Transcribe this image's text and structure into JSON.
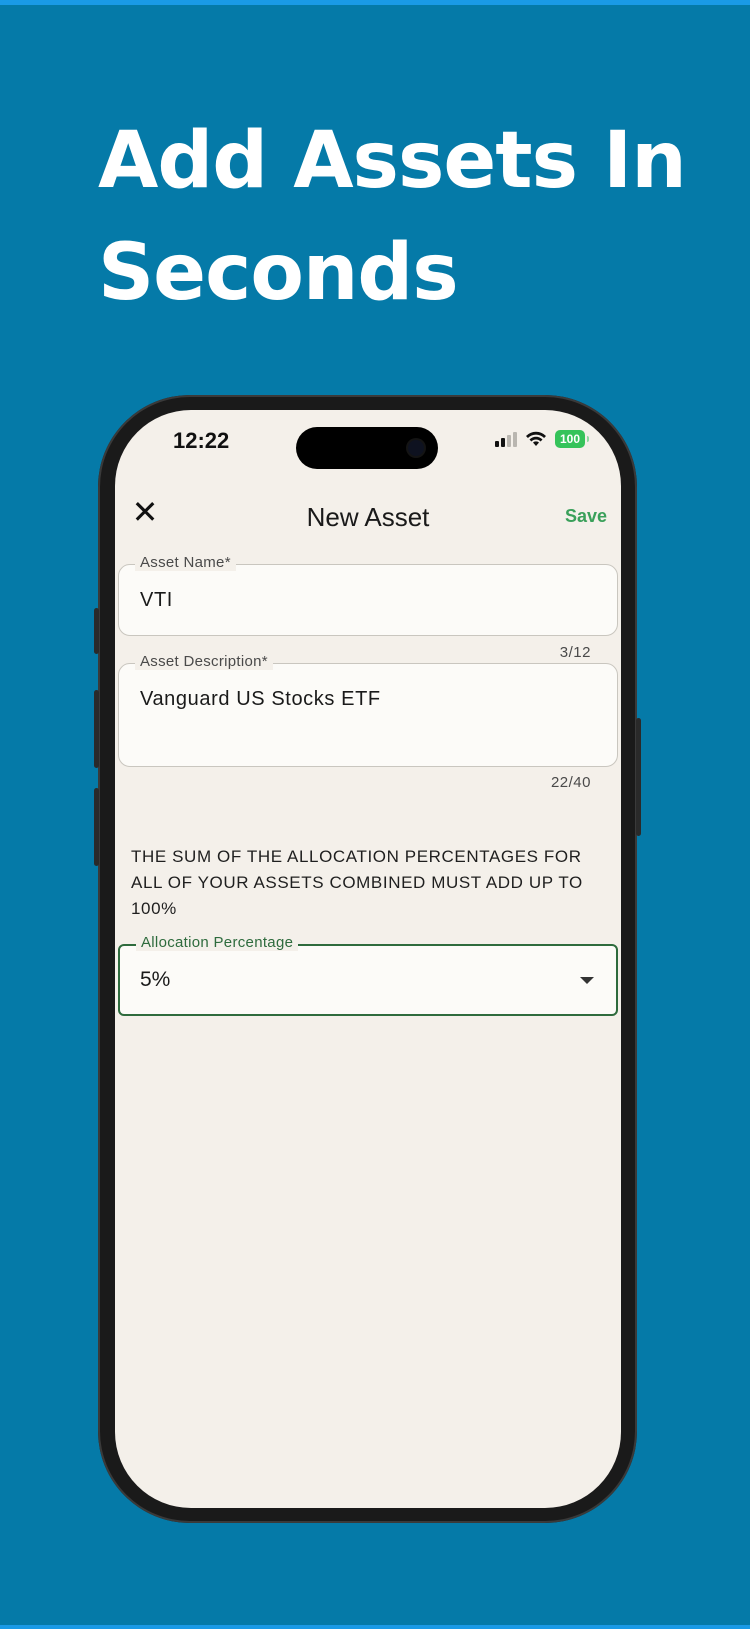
{
  "headline": {
    "line1": "Add Assets In",
    "line2": "Seconds"
  },
  "status_bar": {
    "time": "12:22",
    "battery": "100"
  },
  "nav": {
    "close_icon": "✕",
    "title": "New Asset",
    "save_label": "Save"
  },
  "asset_name": {
    "label": "Asset Name*",
    "value": "VTI",
    "counter": "3/12"
  },
  "asset_description": {
    "label": "Asset Description*",
    "value": "Vanguard US Stocks ETF",
    "counter": "22/40"
  },
  "note": "THE SUM OF THE ALLOCATION PERCENTAGES FOR ALL OF YOUR ASSETS COMBINED MUST ADD UP TO 100%",
  "allocation": {
    "label": "Allocation Percentage",
    "value": "5%"
  },
  "colors": {
    "background": "#057aa8",
    "accent": "#3aa05a",
    "select_border": "#2e6b3d",
    "screen": "#f4f0ea"
  }
}
